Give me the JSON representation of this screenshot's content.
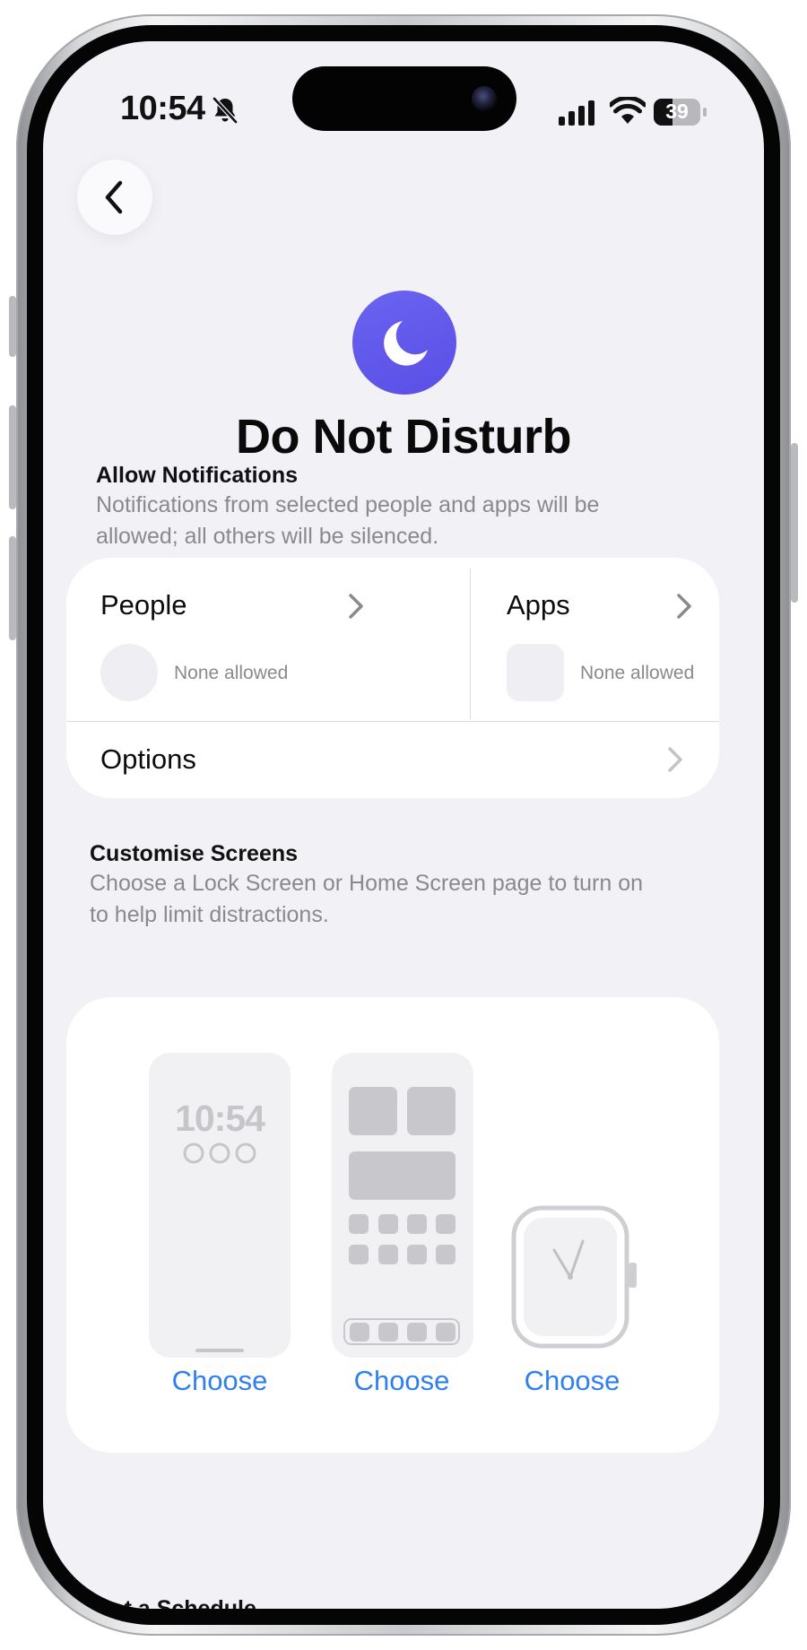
{
  "status_bar": {
    "time": "10:54",
    "battery": "39"
  },
  "header": {
    "title": "Do Not Disturb"
  },
  "allow_notifications": {
    "title": "Allow Notifications",
    "description": "Notifications from selected people and apps will be allowed; all others will be silenced.",
    "people_label": "People",
    "people_status": "None allowed",
    "apps_label": "Apps",
    "apps_status": "None allowed",
    "options_label": "Options"
  },
  "customise_screens": {
    "title": "Customise Screens",
    "description": "Choose a Lock Screen or Home Screen page to turn on to help limit distractions.",
    "lock_screen_time": "10:54",
    "choose_labels": [
      "Choose",
      "Choose",
      "Choose"
    ]
  },
  "next_section": {
    "title": "Set a Schedule"
  },
  "colors": {
    "accent": "#2f80ee",
    "focus_purple": "#5e57ea",
    "background": "#f1f1f6"
  },
  "icons": [
    "bell-slash-icon",
    "cellular-signal-icon",
    "wifi-icon",
    "battery-icon",
    "chevron-left-icon",
    "moon-icon",
    "chevron-right-icon"
  ]
}
